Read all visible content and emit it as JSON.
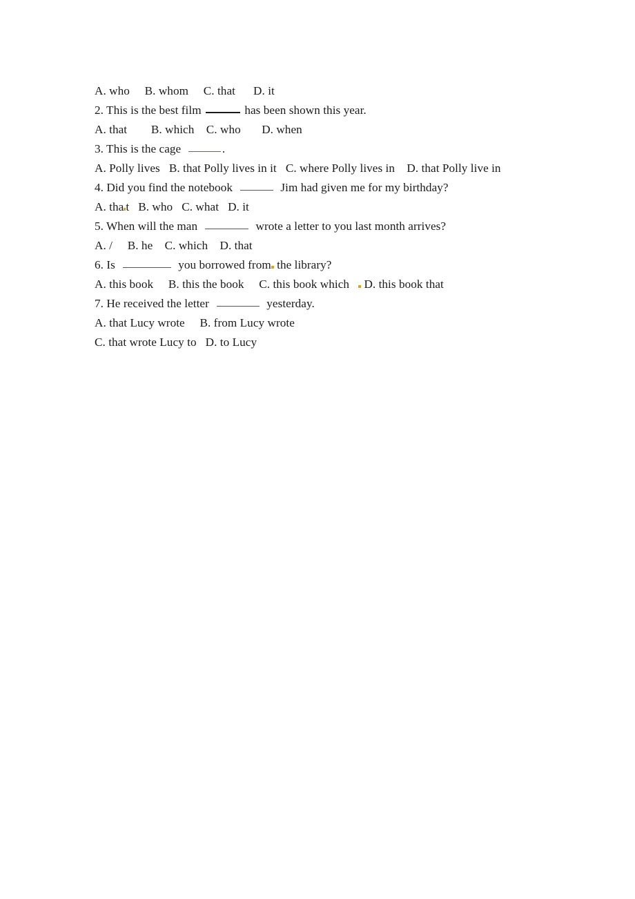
{
  "document": {
    "type": "english-grammar-worksheet",
    "topic": "relative clauses multiple choice",
    "page_background": "#ffffff",
    "text_color": "#1b1b1b",
    "blank_rule_color": "#555555",
    "speck_color": "#d8a521"
  },
  "lines": {
    "l1_options": {
      "a": "A. who",
      "b": "B. whom",
      "c": "C. that",
      "d": "D. it"
    },
    "q2": {
      "number": "2.",
      "before": "2. This is the best film",
      "after": "has been shown this year."
    },
    "q2_options": {
      "a": "A. that",
      "b": "B. which",
      "c": "C. who",
      "d": "D. when"
    },
    "q3": {
      "before": "3. This is the cage",
      "after": "."
    },
    "q3_options": {
      "a": "A. Polly lives",
      "b": "B. that Polly lives in it",
      "c": "C. where Polly lives in",
      "d": "D. that Polly live in"
    },
    "q4": {
      "before": "4. Did you find the notebook",
      "after": "Jim had given me for my birthday?"
    },
    "q4_options": {
      "a_pre": "A. tha",
      "a_post": "t",
      "b": "B. who",
      "c": "C. what",
      "d": "D. it"
    },
    "q5": {
      "before": "5. When will the man",
      "after": "wrote a letter to you last month arrives?"
    },
    "q5_options": {
      "a": "A. /",
      "b": "B. he",
      "c": "C. which",
      "d": "D. that"
    },
    "q6": {
      "before": "6. Is",
      "mid": "you borrowed from",
      "after": "the library?"
    },
    "q6_options": {
      "a": "A. this book",
      "b": "B. this the book",
      "c": "C. this book which",
      "d": "D. this book that"
    },
    "q7": {
      "before": "7. He received the letter",
      "after": "yesterday."
    },
    "q7_options": {
      "a": "A. that Lucy wrote",
      "b": "B. from Lucy wrote",
      "c": "C. that wrote Lucy to",
      "d": "D. to Lucy"
    }
  }
}
